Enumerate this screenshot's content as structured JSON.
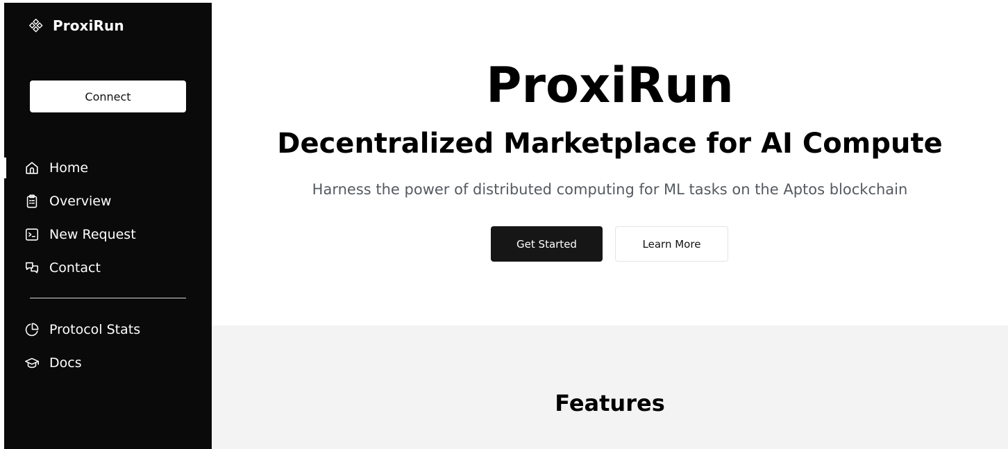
{
  "sidebar": {
    "brand": {
      "name": "ProxiRun",
      "icon": "diamond-cluster-icon"
    },
    "connect_label": "Connect",
    "nav": [
      {
        "label": "Home",
        "icon": "home-icon",
        "active": true
      },
      {
        "label": "Overview",
        "icon": "clipboard-icon",
        "active": false
      },
      {
        "label": "New Request",
        "icon": "terminal-icon",
        "active": false
      },
      {
        "label": "Contact",
        "icon": "chat-icon",
        "active": false
      }
    ],
    "secondary_nav": [
      {
        "label": "Protocol Stats",
        "icon": "pie-chart-icon"
      },
      {
        "label": "Docs",
        "icon": "graduation-cap-icon"
      }
    ]
  },
  "hero": {
    "title": "ProxiRun",
    "subtitle": "Decentralized Marketplace for AI Compute",
    "description": "Harness the power of distributed computing for ML tasks on the Aptos blockchain",
    "primary_button": "Get Started",
    "secondary_button": "Learn More"
  },
  "features": {
    "title": "Features"
  },
  "colors": {
    "sidebar_bg": "#0a0a0a",
    "primary_button_bg": "#161616",
    "features_bg": "#f3f3f3",
    "description_text": "#555a60"
  }
}
